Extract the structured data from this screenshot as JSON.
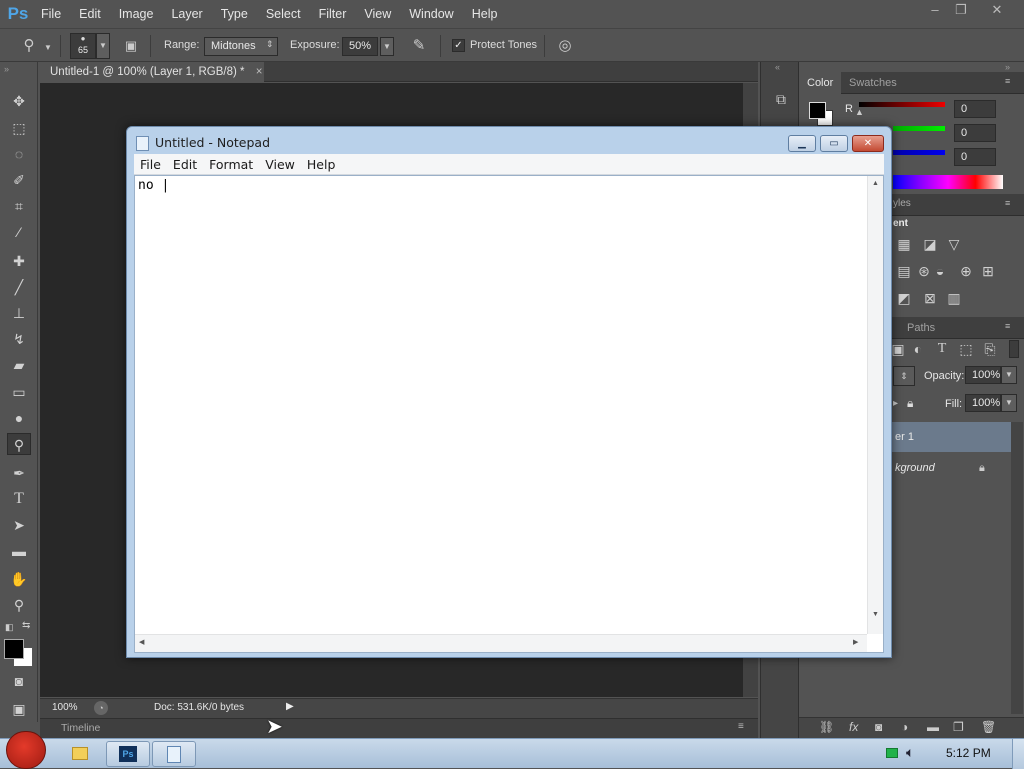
{
  "photoshop": {
    "logo": "Ps",
    "menus": [
      "File",
      "Edit",
      "Image",
      "Layer",
      "Type",
      "Select",
      "Filter",
      "View",
      "Window",
      "Help"
    ],
    "window_controls": {
      "minimize": "–",
      "restore": "❐",
      "close": "✕"
    },
    "options": {
      "brush_size": "65",
      "range_label": "Range:",
      "range_value": "Midtones",
      "exposure_label": "Exposure:",
      "exposure_value": "50%",
      "protect_tones_label": "Protect Tones",
      "protect_tones_checked": true
    },
    "document_tab": {
      "title": "Untitled-1 @ 100% (Layer 1, RGB/8) *",
      "close": "×"
    },
    "tools": [
      "move-icon",
      "marquee-icon",
      "lasso-icon",
      "quick-select-icon",
      "crop-icon",
      "eyedropper-icon",
      "healing-icon",
      "brush-icon",
      "stamp-icon",
      "history-brush-icon",
      "eraser-icon",
      "gradient-icon",
      "blur-icon",
      "dodge-icon",
      "pen-icon",
      "type-icon",
      "path-select-icon",
      "rectangle-icon",
      "hand-icon",
      "zoom-icon"
    ],
    "status": {
      "zoom": "100%",
      "doc": "Doc: 531.6K/0 bytes"
    },
    "timeline_label": "Timeline",
    "color_panel": {
      "tabs": [
        "Color",
        "Swatches"
      ],
      "channel_label": "R",
      "values": [
        "0",
        "0",
        "0"
      ]
    },
    "styles_tab_partial": "yles",
    "adjustments_partial": "ent",
    "layers_panel": {
      "tab_paths": "Paths",
      "opacity_label": "Opacity:",
      "opacity_value": "100%",
      "fill_label": "Fill:",
      "fill_value": "100%",
      "layers": [
        "er 1",
        "kground"
      ]
    }
  },
  "notepad": {
    "title": "Untitled - Notepad",
    "menus": [
      "File",
      "Edit",
      "Format",
      "View",
      "Help"
    ],
    "content": "no |"
  },
  "taskbar": {
    "clock": "5:12 PM",
    "apps": [
      "angry-birds-icon",
      "folder-icon",
      "photoshop-icon",
      "notepad-icon"
    ]
  },
  "colors": {
    "ps_bg": "#535353",
    "canvas": "#282828",
    "ps_accent": "#4fa6e8",
    "taskbar": "#b7cbe0"
  }
}
